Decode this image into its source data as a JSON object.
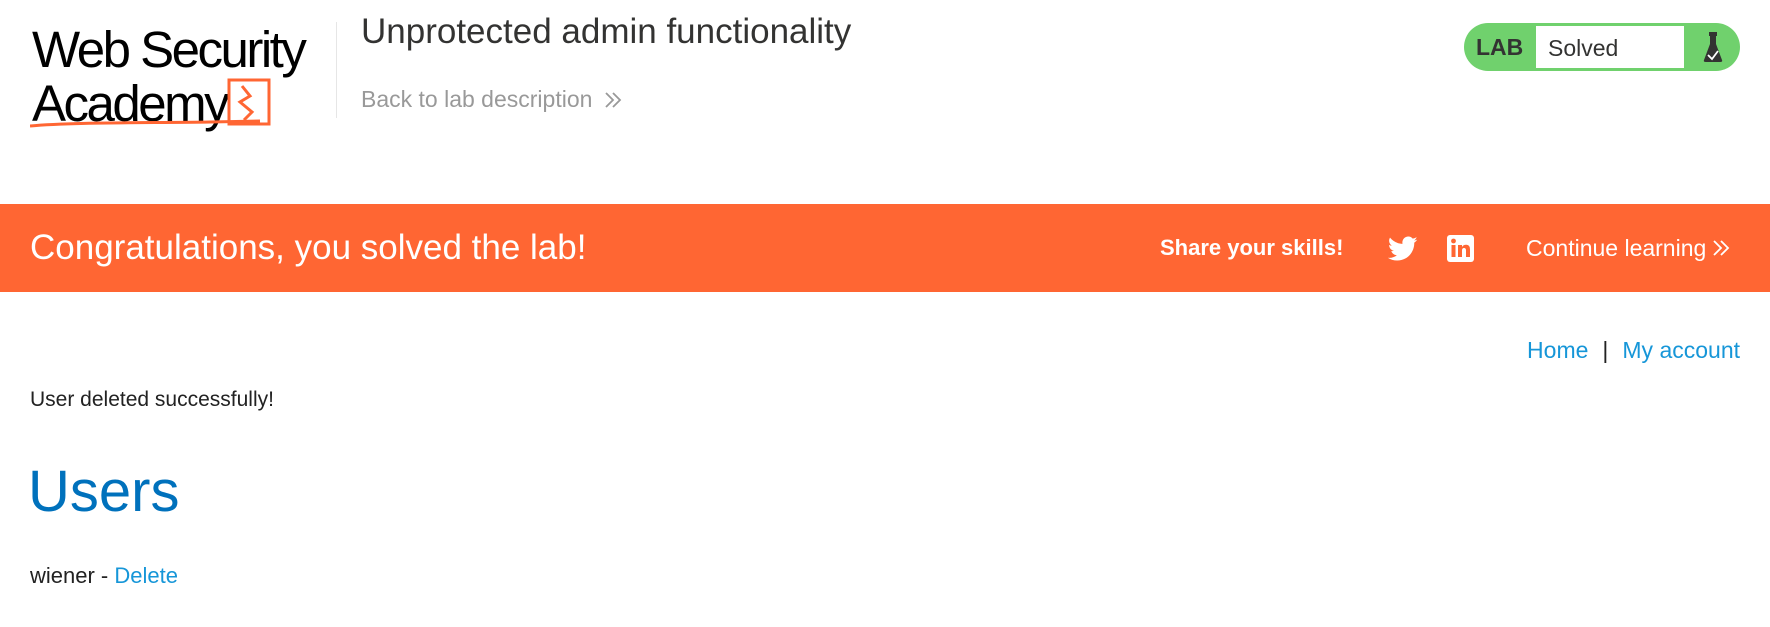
{
  "header": {
    "logo": {
      "line1": "Web Security",
      "line2": "Academy"
    },
    "title": "Unprotected admin functionality",
    "back_link": "Back to lab description",
    "lab_badge": {
      "label": "LAB",
      "status": "Solved",
      "icon": "flask-icon",
      "color": "#70d16d"
    }
  },
  "banner": {
    "message": "Congratulations, you solved the lab!",
    "share_label": "Share your skills!",
    "share_icons": [
      "twitter-icon",
      "linkedin-icon"
    ],
    "continue_label": "Continue learning",
    "color": "#ff6633"
  },
  "nav": {
    "home": "Home",
    "separator": "|",
    "my_account": "My account"
  },
  "main": {
    "status_message": "User deleted successfully!",
    "heading": "Users",
    "users": [
      {
        "name": "wiener",
        "separator": " - ",
        "action": "Delete"
      }
    ]
  },
  "colors": {
    "link": "#1696d8",
    "heading": "#0071bc",
    "muted": "#999999"
  }
}
